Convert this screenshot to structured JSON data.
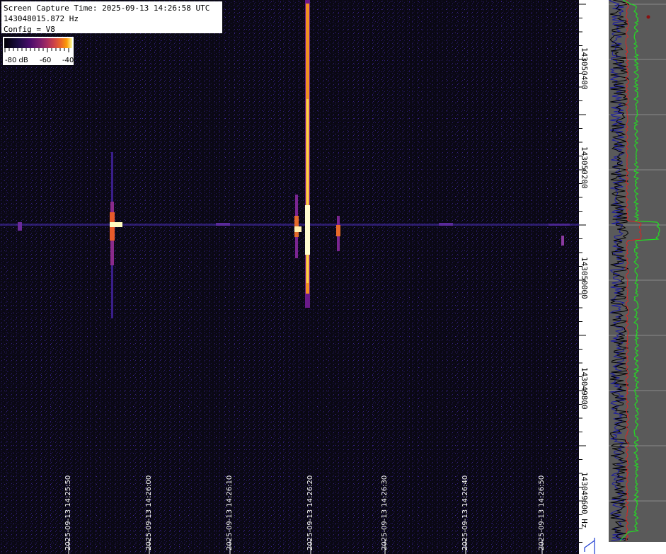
{
  "header": {
    "capture_line": "Screen Capture Time: 2025-09-13 14:26:58 UTC",
    "frequency_line": "143048015.872 Hz",
    "config_line": "Config = V8"
  },
  "colorbar": {
    "labels": [
      "-80 dB",
      "-60",
      "-40"
    ],
    "palette": [
      "#000004",
      "#4a0c6b",
      "#a52c60",
      "#ed6925",
      "#fcffa4"
    ]
  },
  "frequency_axis": {
    "labels": [
      "143050400",
      "143050200",
      "143050000",
      "143049800",
      "143049600 Hz"
    ]
  },
  "time_axis": {
    "labels": [
      "2025-09-13 14:25:50",
      "2025-09-13 14:26:00",
      "2025-09-13 14:26:10",
      "2025-09-13 14:26:20",
      "2025-09-13 14:26:30",
      "2025-09-13 14:26:40",
      "2025-09-13 14:26:50"
    ]
  },
  "colors": {
    "waterfall_background": "#0a0814",
    "spectrum_background": "#5a5a5a",
    "spectrum_green": "#22dd22",
    "spectrum_red": "#dd2222",
    "spectrum_blue": "#1a1aa0"
  }
}
